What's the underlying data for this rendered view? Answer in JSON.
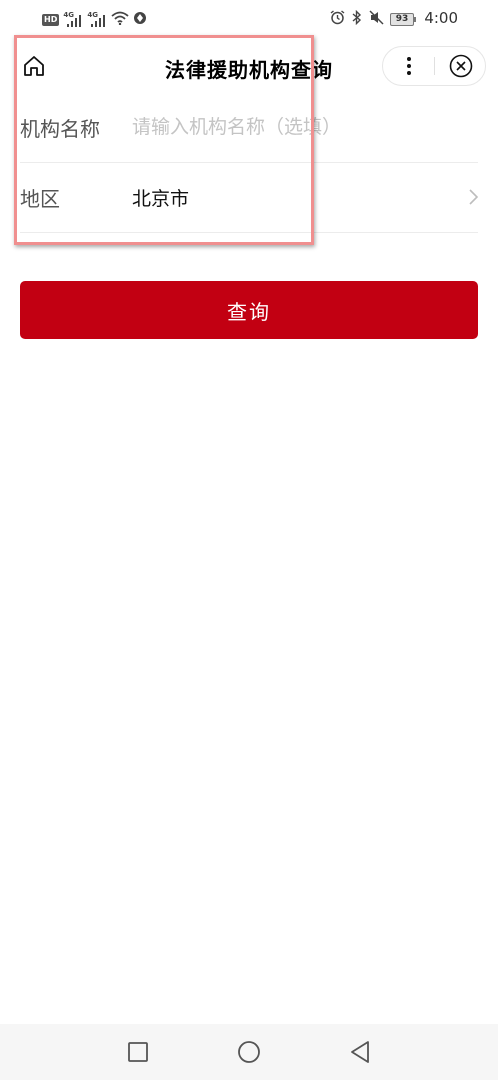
{
  "status_bar": {
    "hd_label": "HD",
    "sim1_label": "4G",
    "sim2_label": "4G",
    "battery_level": "93",
    "time": "4:00",
    "icons": [
      "signal-icon",
      "wifi-icon",
      "vpn-icon",
      "alarm-icon",
      "bluetooth-icon",
      "mute-icon",
      "battery-icon"
    ]
  },
  "nav": {
    "title": "法律援助机构查询",
    "home_icon": "home-icon",
    "more_icon": "more-vertical-icon",
    "close_icon": "close-circle-icon"
  },
  "form": {
    "name_label": "机构名称",
    "name_placeholder": "请输入机构名称（选填）",
    "name_value": "",
    "region_label": "地区",
    "region_value": "北京市"
  },
  "actions": {
    "query_label": "查询"
  },
  "colors": {
    "accent": "#c20012",
    "highlight_border": "#f08f8f"
  }
}
